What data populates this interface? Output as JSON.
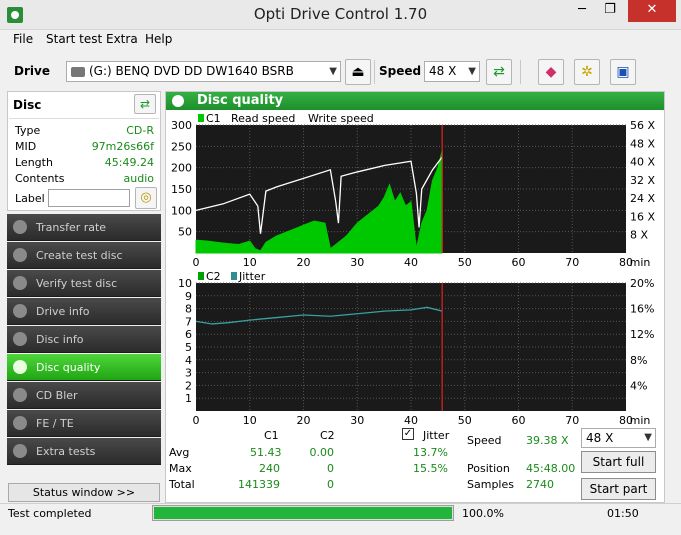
{
  "window": {
    "title": "Opti Drive Control 1.70",
    "min": "─",
    "max": "❐",
    "close": "✕"
  },
  "menu": [
    "File",
    "Start test",
    "Extra",
    "Help"
  ],
  "toolbar": {
    "drive_label": "Drive",
    "drive_value": "(G:)  BENQ DVD DD DW1640 BSRB",
    "speed_label": "Speed",
    "speed_value": "48 X"
  },
  "disc": {
    "header": "Disc",
    "type_label": "Type",
    "type_value": "CD-R",
    "mid_label": "MID",
    "mid_value": "97m26s66f",
    "length_label": "Length",
    "length_value": "45:49.24",
    "contents_label": "Contents",
    "contents_value": "audio",
    "label_label": "Label",
    "label_value": ""
  },
  "nav": [
    {
      "label": "Transfer rate",
      "active": false
    },
    {
      "label": "Create test disc",
      "active": false
    },
    {
      "label": "Verify test disc",
      "active": false
    },
    {
      "label": "Drive info",
      "active": false
    },
    {
      "label": "Disc info",
      "active": false
    },
    {
      "label": "Disc quality",
      "active": true
    },
    {
      "label": "CD Bler",
      "active": false
    },
    {
      "label": "FE / TE",
      "active": false
    },
    {
      "label": "Extra tests",
      "active": false
    }
  ],
  "status_window_button": "Status window >>",
  "panel": {
    "title": "Disc quality"
  },
  "chart_data": [
    {
      "type": "area",
      "legend": [
        "C1",
        "Read speed",
        "Write speed"
      ],
      "xlim": [
        0,
        80
      ],
      "x_ticks": [
        0,
        10,
        20,
        30,
        40,
        50,
        60,
        70,
        80
      ],
      "x_unit": "min",
      "ylim": [
        0,
        300
      ],
      "y_ticks": [
        50,
        100,
        150,
        200,
        250,
        300
      ],
      "y2_ticks": [
        "8 X",
        "16 X",
        "24 X",
        "32 X",
        "40 X",
        "48 X",
        "56 X"
      ],
      "marker_x": 45.8,
      "series": [
        {
          "name": "C1",
          "color": "#00c800",
          "x": [
            0,
            2,
            4,
            6,
            8,
            10,
            11,
            12,
            13,
            15,
            18,
            20,
            22,
            24,
            25,
            26,
            28,
            30,
            32,
            34,
            35,
            36,
            37,
            38,
            39,
            40,
            41,
            41.5,
            42,
            43,
            44,
            45,
            45.8
          ],
          "y": [
            30,
            28,
            25,
            22,
            20,
            28,
            10,
            5,
            25,
            40,
            55,
            65,
            75,
            70,
            10,
            20,
            40,
            70,
            90,
            110,
            130,
            160,
            120,
            140,
            110,
            120,
            10,
            40,
            70,
            100,
            170,
            200,
            240
          ]
        },
        {
          "name": "Read speed",
          "color": "#ffffff",
          "x": [
            0,
            5,
            10,
            11.5,
            12,
            13,
            15,
            20,
            25,
            26,
            26.5,
            27,
            30,
            35,
            40,
            41,
            41.5,
            42,
            44,
            45.8
          ],
          "y": [
            100,
            115,
            138,
            110,
            45,
            145,
            155,
            175,
            195,
            120,
            70,
            180,
            190,
            205,
            215,
            140,
            60,
            150,
            195,
            225
          ]
        }
      ]
    },
    {
      "type": "line",
      "legend": [
        "C2",
        "Jitter"
      ],
      "xlim": [
        0,
        80
      ],
      "x_ticks": [
        0,
        10,
        20,
        30,
        40,
        50,
        60,
        70,
        80
      ],
      "x_unit": "min",
      "ylim": [
        0,
        10
      ],
      "y_ticks": [
        1,
        2,
        3,
        4,
        5,
        6,
        7,
        8,
        9,
        10
      ],
      "y2_ticks": [
        "4%",
        "8%",
        "12%",
        "16%",
        "20%"
      ],
      "marker_x": 45.8,
      "series": [
        {
          "name": "Jitter",
          "color": "#3aa0a0",
          "x": [
            0,
            3,
            6,
            10,
            15,
            20,
            25,
            30,
            35,
            40,
            43,
            45.8
          ],
          "y": [
            7.0,
            6.8,
            6.9,
            7.1,
            7.3,
            7.5,
            7.4,
            7.6,
            7.8,
            7.9,
            8.1,
            7.8
          ]
        }
      ]
    }
  ],
  "stats": {
    "col_c1": "C1",
    "col_c2": "C2",
    "jitter_label": "Jitter",
    "jitter_checked": true,
    "avg_label": "Avg",
    "avg_c1": "51.43",
    "avg_c2": "0.00",
    "avg_jitter": "13.7%",
    "max_label": "Max",
    "max_c1": "240",
    "max_c2": "0",
    "max_jitter": "15.5%",
    "total_label": "Total",
    "total_c1": "141339",
    "total_c2": "0",
    "speed_label": "Speed",
    "speed_value": "39.38 X",
    "speed_select": "48 X",
    "position_label": "Position",
    "position_value": "45:48.00",
    "samples_label": "Samples",
    "samples_value": "2740",
    "start_full": "Start full",
    "start_part": "Start part"
  },
  "status": {
    "text": "Test completed",
    "progress": 1.0,
    "progress_text": "100.0%",
    "time": "01:50"
  }
}
